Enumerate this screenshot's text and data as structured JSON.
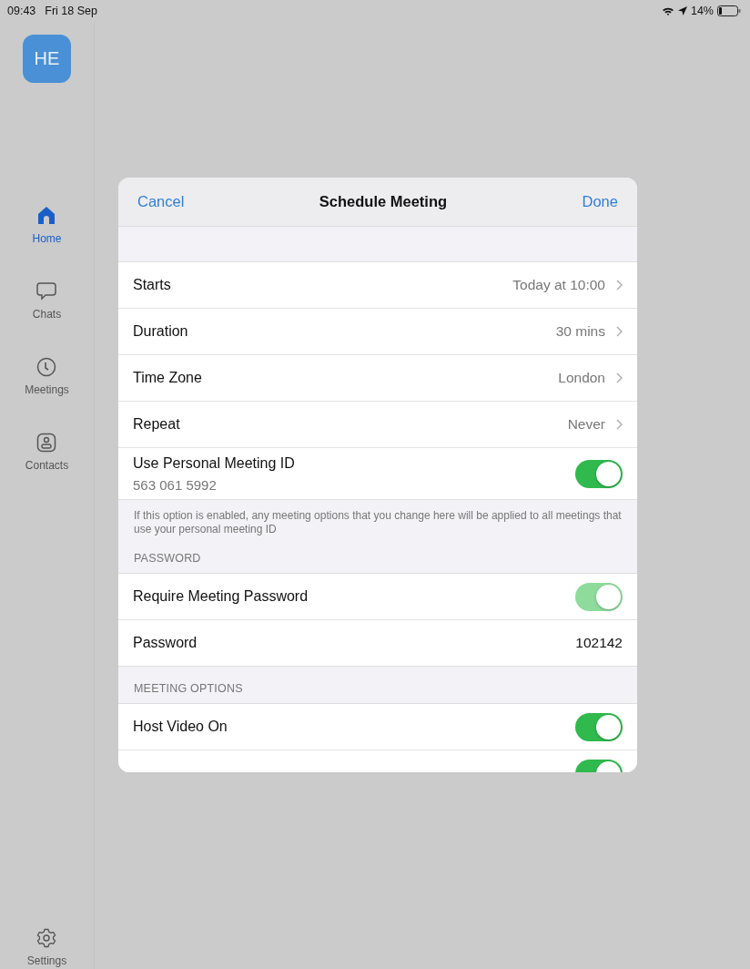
{
  "status_bar": {
    "time": "09:43",
    "date": "Fri 18 Sep",
    "battery": "14%"
  },
  "avatar": {
    "initials": "HE"
  },
  "sidebar": {
    "items": [
      {
        "label": "Home",
        "selected": true
      },
      {
        "label": "Chats",
        "selected": false
      },
      {
        "label": "Meetings",
        "selected": false
      },
      {
        "label": "Contacts",
        "selected": false
      }
    ],
    "bottom_item": {
      "label": "Settings",
      "selected": false
    }
  },
  "dialog": {
    "title": "Schedule Meeting",
    "cancel": "Cancel",
    "done": "Done",
    "sections": [
      {
        "rows": [
          {
            "kind": "value",
            "label": "Starts",
            "value": "Today at 10:00",
            "chevron": true
          },
          {
            "kind": "value",
            "label": "Duration",
            "value": "30 mins",
            "chevron": true
          },
          {
            "kind": "value",
            "label": "Time Zone",
            "value": "London",
            "chevron": true
          },
          {
            "kind": "value",
            "label": "Repeat",
            "value": "Never",
            "chevron": true
          },
          {
            "kind": "toggle",
            "label": "Use Personal Meeting ID",
            "sublabel": "563 061 5992",
            "on": true,
            "disabled": false
          }
        ],
        "footer": "If this option is enabled, any meeting options that you change here will be applied to all meetings that use your personal meeting ID"
      },
      {
        "header": "PASSWORD",
        "rows": [
          {
            "kind": "toggle",
            "label": "Require Meeting Password",
            "on": true,
            "disabled": true
          },
          {
            "kind": "value",
            "label": "Password",
            "value": "102142",
            "chevron": false
          }
        ]
      },
      {
        "header": "MEETING OPTIONS",
        "rows": [
          {
            "kind": "toggle",
            "label": "Host Video On",
            "on": true,
            "disabled": false
          },
          {
            "kind": "toggle",
            "on": true,
            "disabled": false
          }
        ]
      }
    ]
  }
}
